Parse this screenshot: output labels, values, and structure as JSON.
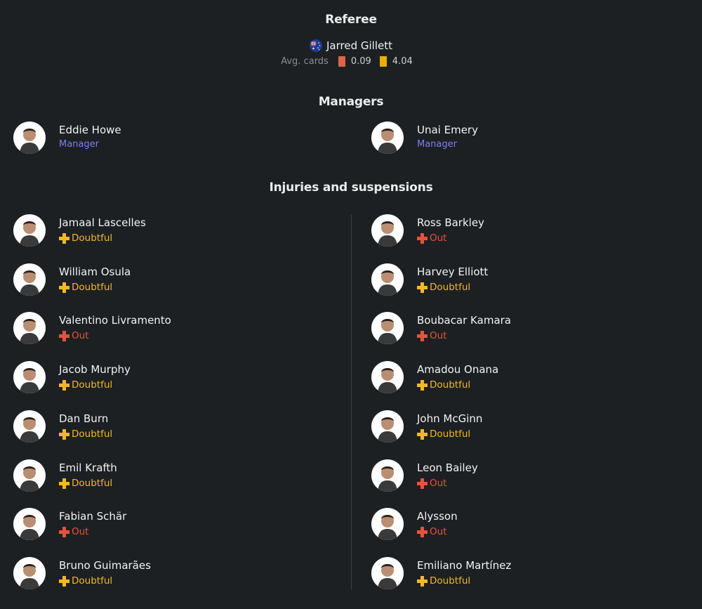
{
  "referee": {
    "title": "Referee",
    "name": "Jarred Gillett",
    "flag_icon": "australia-flag-icon",
    "avg_cards_label": "Avg. cards",
    "red_cards": "0.09",
    "yellow_cards": "4.04"
  },
  "managers": {
    "title": "Managers",
    "home": {
      "name": "Eddie Howe",
      "role": "Manager"
    },
    "away": {
      "name": "Unai Emery",
      "role": "Manager"
    }
  },
  "injuries": {
    "title": "Injuries and suspensions",
    "home": [
      {
        "name": "Jamaal Lascelles",
        "status": "Doubtful"
      },
      {
        "name": "William Osula",
        "status": "Doubtful"
      },
      {
        "name": "Valentino Livramento",
        "status": "Out"
      },
      {
        "name": "Jacob Murphy",
        "status": "Doubtful"
      },
      {
        "name": "Dan Burn",
        "status": "Doubtful"
      },
      {
        "name": "Emil Krafth",
        "status": "Doubtful"
      },
      {
        "name": "Fabian Schär",
        "status": "Out"
      },
      {
        "name": "Bruno Guimarães",
        "status": "Doubtful"
      }
    ],
    "away": [
      {
        "name": "Ross Barkley",
        "status": "Out"
      },
      {
        "name": "Harvey Elliott",
        "status": "Doubtful"
      },
      {
        "name": "Boubacar Kamara",
        "status": "Out"
      },
      {
        "name": "Amadou Onana",
        "status": "Doubtful"
      },
      {
        "name": "John McGinn",
        "status": "Doubtful"
      },
      {
        "name": "Leon Bailey",
        "status": "Out"
      },
      {
        "name": "Alysson",
        "status": "Out"
      },
      {
        "name": "Emiliano Martínez",
        "status": "Doubtful"
      }
    ]
  },
  "colors": {
    "background": "#1d2023",
    "doubtful": "#f2b72b",
    "out": "#e5533d",
    "manager_role": "#7b7ff0",
    "red_card": "#e2614a",
    "yellow_card": "#e6b100"
  }
}
